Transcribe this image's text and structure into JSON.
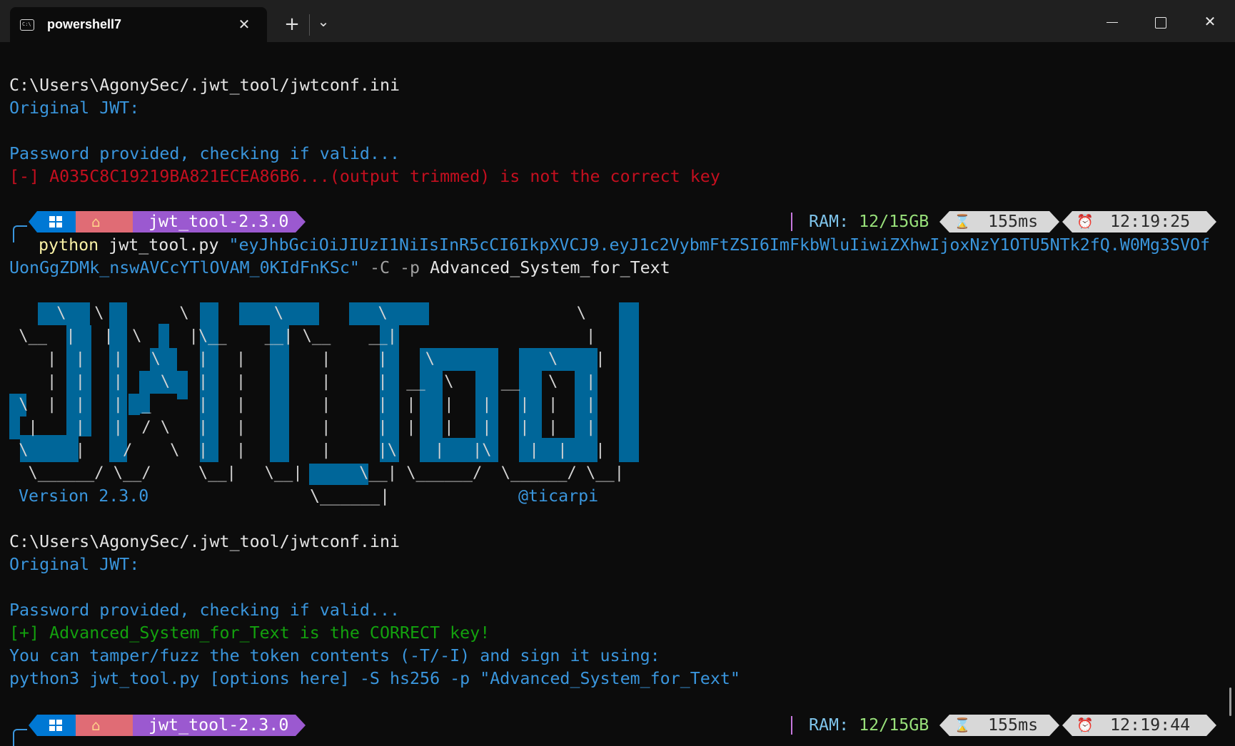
{
  "window": {
    "tab_title": "powershell7",
    "tab_icon": "terminal-icon",
    "new_tab_label": "+",
    "dropdown_label": "⌄",
    "close_tab_label": "✕",
    "close_window_label": "✕"
  },
  "block1": {
    "config_path": "C:\\Users\\AgonySec/.jwt_tool/jwtconf.ini",
    "original_jwt": "Original JWT:",
    "checking": "Password provided, checking if valid...",
    "result": "[-] A035C8C19219BA821ECEA86B6...(output trimmed) is not the correct key"
  },
  "prompt1": {
    "dir": "jwt_tool-2.3.0",
    "ram_label": "RAM: ",
    "ram_value": "12/15GB",
    "duration": "155ms",
    "time": "12:19:25"
  },
  "command": {
    "exe": "python",
    "script": " jwt_tool.py ",
    "token_part1": "\"eyJhbGciOiJIUzI1NiIsInR5cCI6IkpXVCJ9.eyJ1c2VybmFtZSI6ImFkbWluIiwiZXhwIjoxNzY1OTU5NTk2fQ.W0Mg3SVOf",
    "token_part2": "UonGgZDMk_nswAVCcYTlOVAM_0KIdFnKSc\"",
    "flags": " -C -p ",
    "password": "Advanced_System_for_Text"
  },
  "banner": {
    "ascii_lines": [
      "     \\   \\        \\         \\          \\                    \\",
      " \\__  |   |  \\     |\\__    __| \\__    __|                    |",
      "    |  |   |   \\    |   |        |     |    \\            \\    |",
      "    |  |   |    \\   |   |        |     |  __  \\     __   \\   |",
      " \\  |  |   |  _     |   |        |     |  |   |   |   |  |   |",
      "  |    |   |  / \\   |   |        |     |  |   |   |   |  |   |",
      " \\     |    /    \\  |   |        |     |\\    |   |\\    |  |   |",
      "  \\______/ \\__/     \\__|   \\__|      \\__| \\______/  \\______/ \\__|"
    ],
    "version": "Version 2.3.0",
    "underline": "\\______|",
    "author": "@ticarpi"
  },
  "block2": {
    "config_path": "C:\\Users\\AgonySec/.jwt_tool/jwtconf.ini",
    "original_jwt": "Original JWT:",
    "checking": "Password provided, checking if valid...",
    "result": "[+] Advanced_System_for_Text is the CORRECT key!",
    "tamper_hint": "You can tamper/fuzz the token contents (-T/-I) and sign it using:",
    "sign_command": "python3 jwt_tool.py [options here] -S hs256 -p \"Advanced_System_for_Text\""
  },
  "prompt2": {
    "dir": "jwt_tool-2.3.0",
    "ram_label": "RAM: ",
    "ram_value": "12/15GB",
    "duration": "155ms",
    "time": "12:19:44"
  },
  "colors": {
    "background": "#0c0c0c",
    "ascii_block": "#006699",
    "info_blue": "#3a96dd",
    "error_red": "#c50f1f",
    "success_green": "#13a10e"
  }
}
